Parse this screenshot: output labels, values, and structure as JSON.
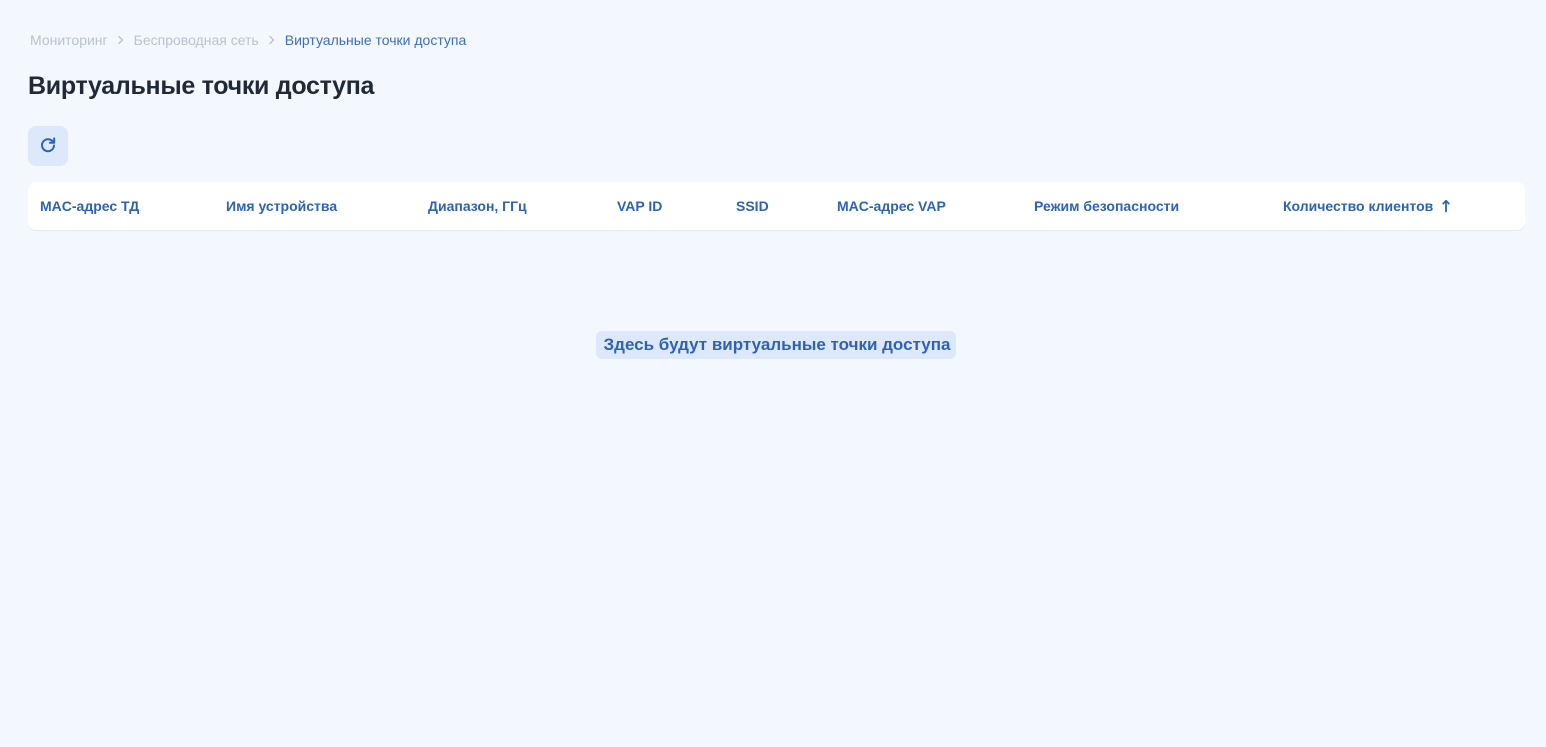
{
  "breadcrumb": {
    "items": [
      {
        "label": "Мониторинг"
      },
      {
        "label": "Беспроводная сеть"
      },
      {
        "label": "Виртуальные точки доступа"
      }
    ]
  },
  "page": {
    "title": "Виртуальные точки доступа"
  },
  "toolbar": {
    "refresh_icon": "refresh-icon"
  },
  "table": {
    "columns": [
      {
        "label": "MAC-адрес ТД"
      },
      {
        "label": "Имя устройства"
      },
      {
        "label": "Диапазон, ГГц"
      },
      {
        "label": "VAP ID"
      },
      {
        "label": "SSID"
      },
      {
        "label": "MAC-адрес VAP"
      },
      {
        "label": "Режим безопасности"
      },
      {
        "label": "Количество клиентов",
        "sort": "ascending"
      }
    ],
    "rows": [],
    "empty_text": "Здесь будут виртуальные точки доступа"
  },
  "colors": {
    "background": "#f3f7fe",
    "accent": "#2f62b5",
    "button_bg": "#dde9fb",
    "breadcrumb_inactive": "#b9c3cf"
  }
}
